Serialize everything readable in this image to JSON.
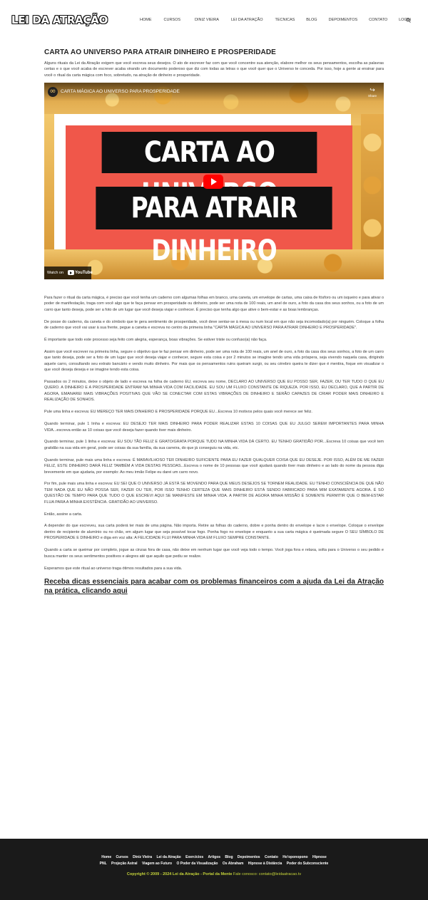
{
  "header": {
    "logo": "LEI DA ATRAÇÃO",
    "nav": [
      "HOME",
      "CURSOS",
      "DINIZ VIEIRA",
      "LEI DA ATRAÇÃO",
      "TECNICAS",
      "BLOG",
      "DEPOIMENTOS",
      "CONTATO",
      "LOGIN"
    ],
    "search_icon": "search-icon"
  },
  "article": {
    "title": "CARTA AO UNIVERSO PARA ATRAIR DINHEIRO E PROSPERIDADE",
    "intro": "Alguns rituais da Lei da Atração exigem que você escreva seus desejos. O ato de escrever faz com que você concentre sua atenção, elabore melhor os seus pensamentos, escolha as palavras certas e o que você acaba de escrever acaba virando um documento poderoso que diz com todas as letras o que você quer que o Universo te conceda. Por isso, hoje a gente ai ensinar para você o ritual da carta mágica com foco, sobretudo, na atração de dinheiro e prosperidade."
  },
  "video": {
    "title": "CARTA MÁGICA AO UNIVERSO PARA PROSPERIDADE",
    "banner_line1": "CARTA AO UNIVERSO",
    "banner_line2": "PARA ATRAIR DINHEIRO",
    "share": "Share",
    "watch_on": "Watch on",
    "youtube": "YouTube"
  },
  "body": {
    "paragraphs": [
      "Para fazer o ritual da carta mágica, é preciso que você tenha um caderno com algumas folhas em branco, uma caneta, um envelope de cartas, uma caixa de fósforo ou um isqueiro e para ativar o poder de manifestação, traga com você algo que te faça pensar em prosperidade ou dinheiro, pode ser uma nota de 100 reais, um anel de ouro, a foto da casa dos seus sonhos, ou a foto de um carro que tanto deseja, pode ser a foto de um lugar que você deseja viajar e conhecer. É preciso que tenha algo que ative o bem-estar e as boas lembranças.",
      "De posse do caderno, da caneta e do símbolo que te gera sentimento de prosperidade, você deve sentar-se à mesa ou num local em que não seja incomodado(a) por ninguém. Coloque a folha de caderno que você vai usar à sua frente, pegue a caneta e escreva no centro da primeira linha \"CARTA MÁGICA AO UNIVERSO PARA ATRAIR DINHEIRO E PROSPERIDADE\".",
      "É importante que todo este processo seja feito com alegria, esperança, boas vibrações. Se estiver triste ou confuso(a) não faça.",
      "Assim que você escrever na primeira linha, segure o objetivo que te faz pensar em dinheiro, pode ser uma nota de 100 reais, um anel de ouro, a foto da casa dos seus sonhos, a foto de um carro que tanto deseja, pode ser a foto de um lugar que você deseja viajar e conhecer, segure esta coisa e por 2 minutos se imagine tendo uma vida próspera, seja vivendo naquela casa, dirigindo aquele carro, consultando seu extrato bancário e vendo muito dinheiro. Por mais que os pensamentos ruins queiram surgir, ou seu cérebro queira te dizer que é mentira, foque em visualizar o que você deseja deseja e se imagine tendo esta coisa.",
      "Passados os 2 minutos, deixe o objeto de lado e escreva na folha de caderno EU, escreva seu nome, DECLARO AO UNIVERSO QUE EU POSSO SER, FAZER, OU TER TUDO O QUE EU QUERO. A DINHEIRO E A PROSPERIDADE ENTRAM NA MINHA VIDA COM FACILIDADE. EU SOU UM FLUXO CONSTANTE DE RIQUEZA. POR ISSO, EU DECLARO, QUE A PARTIR DE AGORA, EMANAREI MAIS VIBRAÇÕES POSITIVAS QUE VÃO SE CONECTAR COM ESTAS VIBRAÇÕES DE DINHEIRO E SERÃO CAPAZES DE CRIAR PODER MAIS DINHEIRO E REALIZAÇÃO DE SONHOS.",
      "Pule uma linha e escreva: EU MEREÇO TER MAIS DINHEIRO E PROSPERIDADE PORQUE EU...Escreva 10 motivos pelos quais você merece ser feliz.",
      "Quando terminar, pule 1 linha e escreva: EU DESEJO TER MAIS DINHEIRO PARA PODER REALIZAR ESTAS 10 COISAS QUE EU JULGO SEREM IMPORTANTES PARA MINHA VIDA...escreva então as 10 coisas que você deseja fazer quando tiver mais dinheiro.",
      "Quando terminar, pule 1 linha e escreva: EU SOU TÃO FELIZ E GRATO/GRATA PORQUE TUDO NA MINHA VIDA DÁ CERTO. EU TENHO GRATIDÃO POR...Escreva 10 coisas que você tem gratidão na sua vida em geral, pode ser coisas da sua família, da sua carreira, do que já conseguiu na vida, etc.",
      "Quando terminar, pule mais uma linha e escreva: É MARAVILHOSO TER DINHEIRO SUFICIENTE PARA EU FAZER QUALQUER COISA QUE EU DESEJE. POR ISSO, ALÉM DE ME FAZER FELIZ, ESTE DINHEIRO DARÁ FELIZ TAMBÉM A VIDA DESTAS PESSOAS...Escreva o nome de 10 pessoas que você ajudará quando tiver mais dinheiro e ao lado do nome da pessoa diga brevemente em que ajudaria, por exemplo: Ao meu irmão Felipe eu darei um carro novo.",
      "Por fim, pule mais uma linha e escreva: EU SEI QUE O UNIVERSO JÁ ESTÁ SE MOVENDO PARA QUE MEUS DESEJOS SE TORNEM REALIDADE. EU TENHO CONSCIÊNCIA DE QUE NÃO TEM NADA QUE EU NÃO POSSA SER, FAZER OU TER, POR ISSO TENHO CERTEZA QUE MAIS DINHEIRO ESTÁ SENDO FABRICADO PARA MIM EXATAMENTE AGORA. É SÓ QUESTÃO DE TEMPO PARA QUE TUDO O QUE ESCREVI AQUI SE MANIFESTE EM MINHA VIDA. A PARTIR DE AGORA MINHA MISSÃO É SOMENTE PERMITIR QUE O BEM-ESTAR FLUA PARA A MINHA EXISTÊNCIA. GRATIDÃO AO UNIVERSO.",
      "Então, assine a carta.",
      "A depender do que escreveu, sua carta poderá ter mais de uma página. Não importa. Retire as folhas do caderno, dobre e ponha dentro do envelope e lacre o envelope. Coloque o envelope dentro de recipiente de alumínio ou no chão, em algum lugar que seja possível tocar fogo. Ponha fogo no envelope e enquanto a sua carta mágica é queimada segure O SEU SÍMBOLO DE PROSPERIDADE E DINHEIRO e diga em voz alta: A FELICIDADE FLUI PARA MINHA VIDA EM FLUXO SEMPRE CONSTANTE.",
      "Quando a carta se queimar por completo, jogue as cinzas fora de casa, não deixe em nenhum lugar que você veja todo o tempo. Você joga fora e relaxa, solta para o Universo o seu pedido e busca manter os seus sentimentos positivos e alegres até que aquilo que pediu se realize.",
      "Esperamos que este ritual ao universo traga ótimos resultados para a sua vida."
    ],
    "cta": "Receba dicas essenciais para acabar com os problemas financeiros com a ajuda da Lei da Atração na prática, clicando aqui"
  },
  "footer": {
    "row1": [
      "Home",
      "Cursos",
      "Diniz Vieira",
      "Lei da Atração",
      "Exercícios",
      "Artigos",
      "Blog",
      "Depoimentos",
      "Contato",
      "Ho'oponopono",
      "Hipnose"
    ],
    "row2": [
      "PNL",
      "Projeção Astral",
      "Viagem ao Futuro",
      "O Poder da Visualização",
      "Os Abraham",
      "Hipnose à Distância",
      "Poder do Subconsciente"
    ],
    "copyright": "Copyright © 2009 - 2024 Lei da Atração - Portal da Mente",
    "contact_label": "Fale conosco:",
    "email": "contato@leidaatracao.tv"
  }
}
